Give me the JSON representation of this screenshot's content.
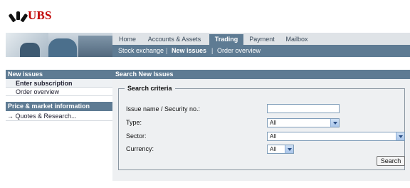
{
  "brand": {
    "name": "UBS"
  },
  "top_nav": {
    "tabs": [
      {
        "label": "Home",
        "active": false
      },
      {
        "label": "Accounts & Assets",
        "active": false
      },
      {
        "label": "Trading",
        "active": true
      },
      {
        "label": "Payment",
        "active": false
      },
      {
        "label": "Mailbox",
        "active": false
      }
    ]
  },
  "sub_nav": {
    "items": [
      {
        "label": "Stock exchange",
        "active": false
      },
      {
        "label": "New issues",
        "active": true
      },
      {
        "label": "Order overview",
        "active": false
      }
    ],
    "separator": "|"
  },
  "sidebar": {
    "section1_title": "New issues",
    "section1_items": [
      {
        "label": "Enter subscription",
        "active": true
      },
      {
        "label": "Order overview",
        "active": false
      }
    ],
    "section2_title": "Price & market information",
    "section2_items": [
      {
        "label": "Quotes & Research...",
        "icon": "arrow-right-icon"
      }
    ]
  },
  "main": {
    "title": "Search New Issues",
    "fieldset_legend": "Search criteria",
    "fields": {
      "issue_label": "Issue name / Security no.:",
      "issue_value": "",
      "type_label": "Type:",
      "type_value": "All",
      "sector_label": "Sector:",
      "sector_value": "All",
      "currency_label": "Currency:",
      "currency_value": "All"
    },
    "search_button": "Search"
  },
  "colors": {
    "accent": "#5e7b93",
    "brand_red": "#c00000",
    "nav_bg": "#dfe3e7",
    "content_bg": "#eef0f2"
  }
}
